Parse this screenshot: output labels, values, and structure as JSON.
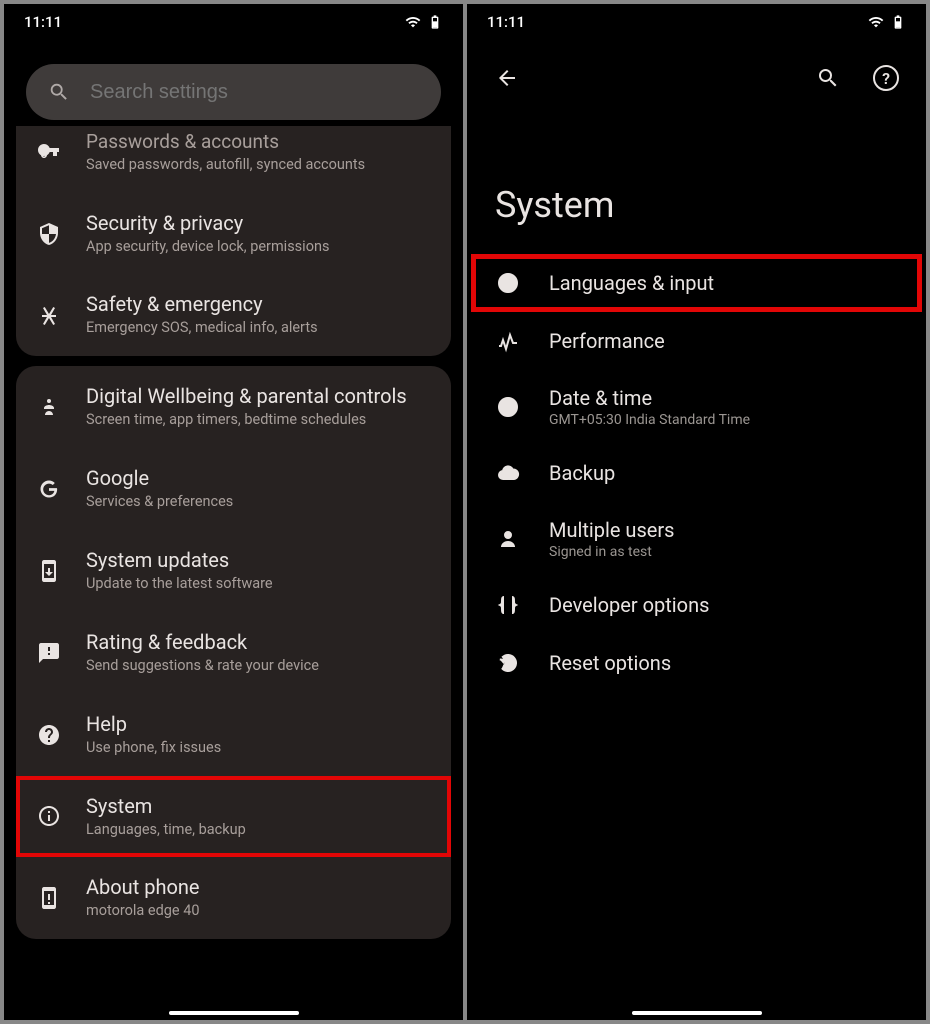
{
  "status": {
    "time": "11:11"
  },
  "left": {
    "search_placeholder": "Search settings",
    "card1": [
      {
        "title": "Passwords & accounts",
        "sub": "Saved passwords, autofill, synced accounts",
        "icon": "key"
      },
      {
        "title": "Security & privacy",
        "sub": "App security, device lock, permissions",
        "icon": "shield"
      },
      {
        "title": "Safety & emergency",
        "sub": "Emergency SOS, medical info, alerts",
        "icon": "asterisk"
      }
    ],
    "card2": [
      {
        "title": "Digital Wellbeing & parental controls",
        "sub": "Screen time, app timers, bedtime schedules",
        "icon": "wellbeing"
      },
      {
        "title": "Google",
        "sub": "Services & preferences",
        "icon": "google"
      },
      {
        "title": "System updates",
        "sub": "Update to the latest software",
        "icon": "phone-update"
      },
      {
        "title": "Rating & feedback",
        "sub": "Send suggestions & rate your device",
        "icon": "feedback"
      },
      {
        "title": "Help",
        "sub": "Use phone, fix issues",
        "icon": "help"
      },
      {
        "title": "System",
        "sub": "Languages, time, backup",
        "icon": "info",
        "highlight": true
      },
      {
        "title": "About phone",
        "sub": "motorola edge 40",
        "icon": "phone-info"
      }
    ]
  },
  "right": {
    "page_title": "System",
    "items": [
      {
        "title": "Languages & input",
        "sub": "",
        "icon": "globe",
        "highlight": true
      },
      {
        "title": "Performance",
        "sub": "",
        "icon": "performance"
      },
      {
        "title": "Date & time",
        "sub": "GMT+05:30 India Standard Time",
        "icon": "clock"
      },
      {
        "title": "Backup",
        "sub": "",
        "icon": "cloud"
      },
      {
        "title": "Multiple users",
        "sub": "Signed in as test",
        "icon": "user"
      },
      {
        "title": "Developer options",
        "sub": "",
        "icon": "braces"
      },
      {
        "title": "Reset options",
        "sub": "",
        "icon": "reset"
      }
    ]
  }
}
